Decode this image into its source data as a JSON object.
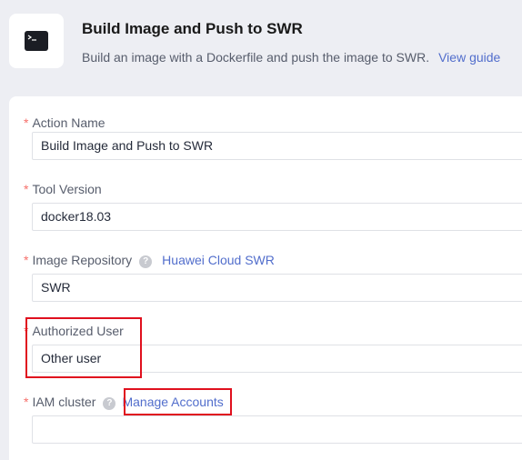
{
  "header": {
    "title": "Build Image and Push to SWR",
    "description": "Build an image with a Dockerfile and push the image to SWR.",
    "guide_link": "View guide",
    "icon": "terminal-icon"
  },
  "form": {
    "required_mark": "*",
    "action_name": {
      "label": "Action Name",
      "value": "Build Image and Push to SWR"
    },
    "tool_version": {
      "label": "Tool Version",
      "value": "docker18.03"
    },
    "image_repository": {
      "label": "Image Repository",
      "help_icon": "question-icon",
      "help_glyph": "?",
      "link": "Huawei Cloud SWR",
      "value": "SWR"
    },
    "authorized_user": {
      "label": "Authorized User",
      "value": "Other user"
    },
    "iam_cluster": {
      "label": "IAM cluster",
      "help_icon": "question-icon",
      "help_glyph": "?",
      "link": "Manage Accounts",
      "value": ""
    }
  },
  "colors": {
    "accent": "#526ecc",
    "required": "#f66f6a",
    "highlight": "#e0101e"
  }
}
